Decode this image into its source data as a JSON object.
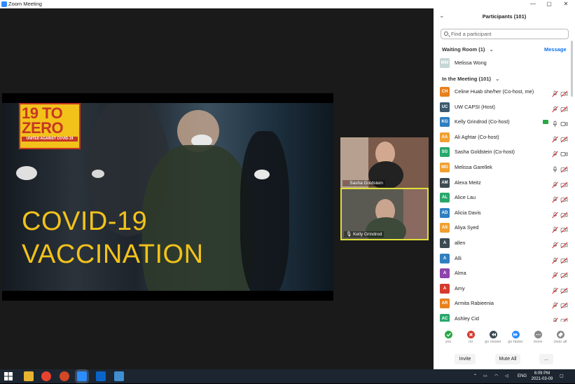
{
  "window": {
    "title": "Zoom Meeting",
    "controls": [
      "—",
      "▢",
      "✕"
    ]
  },
  "slide": {
    "logo_line1": "19 TO",
    "logo_line2": "ZERO",
    "logo_sub": "UNITED AGAINST COVID-19",
    "line1": "COVID-19",
    "line2": "VACCINATION"
  },
  "video_tiles": [
    {
      "name": "Sasha Goldstein",
      "active": false
    },
    {
      "name": "Kelly Grindrod",
      "active": true
    }
  ],
  "panel": {
    "title": "Participants (101)",
    "search_placeholder": "Find a participant",
    "waiting_room_label": "Waiting Room (1)",
    "message_label": "Message",
    "waiting": [
      {
        "initials": "MW",
        "name": "Melissa Wong",
        "color": "#c5d6d4"
      }
    ],
    "in_meeting_label": "In the Meeting (101)",
    "participants": [
      {
        "initials": "CH",
        "name": "Celine Huab she/her (Co-host, me)",
        "color": "#e8801c",
        "mic": "muted",
        "video": "off"
      },
      {
        "initials": "UC",
        "name": "UW CAPSI (Host)",
        "color": "#3c5a6e",
        "mic": "muted",
        "video": "off"
      },
      {
        "initials": "KG",
        "name": "Kelly Grindrod (Co-host)",
        "color": "#2f7fc1",
        "mic": "on",
        "video": "on",
        "share": true
      },
      {
        "initials": "AA",
        "name": "Ali Aghtar (Co-host)",
        "color": "#f0a030",
        "mic": "muted",
        "video": "off"
      },
      {
        "initials": "SG",
        "name": "Sasha Goldstein (Co-host)",
        "color": "#27a86a",
        "mic": "muted",
        "video": "on"
      },
      {
        "initials": "MG",
        "name": "Melissa Garellek",
        "color": "#f0a030",
        "mic": "on",
        "video": "off"
      },
      {
        "initials": "AM",
        "name": "Alexa Meitz",
        "color": "#3c4a52",
        "mic": "muted",
        "video": "off"
      },
      {
        "initials": "AL",
        "name": "Alice Lau",
        "color": "#27a86a",
        "mic": "muted",
        "video": "off"
      },
      {
        "initials": "AD",
        "name": "Alicia Davis",
        "color": "#2f7fc1",
        "mic": "muted",
        "video": "off"
      },
      {
        "initials": "AS",
        "name": "Aliya Syed",
        "color": "#f0a030",
        "mic": "muted",
        "video": "off"
      },
      {
        "initials": "A",
        "name": "allen",
        "color": "#3c4a52",
        "mic": "muted",
        "video": "off"
      },
      {
        "initials": "A",
        "name": "Alli",
        "color": "#2f7fc1",
        "mic": "muted",
        "video": "off"
      },
      {
        "initials": "A",
        "name": "Alma",
        "color": "#8e44ad",
        "mic": "muted",
        "video": "off"
      },
      {
        "initials": "A",
        "name": "Amy",
        "color": "#d63a2f",
        "mic": "muted",
        "video": "off"
      },
      {
        "initials": "AR",
        "name": "Armita Rabieenia",
        "color": "#e8801c",
        "mic": "muted",
        "video": "off"
      },
      {
        "initials": "AC",
        "name": "Ashley Cid",
        "color": "#27a86a",
        "mic": "muted",
        "video": "off"
      }
    ],
    "reactions": [
      {
        "label": "yes",
        "color": "#27a844",
        "icon": "check-icon"
      },
      {
        "label": "no",
        "color": "#d63a2f",
        "icon": "x-icon"
      },
      {
        "label": "go slower",
        "color": "#3c4a52",
        "icon": "rewind-icon"
      },
      {
        "label": "go faster",
        "color": "#2d8cff",
        "icon": "fast-forward-icon"
      },
      {
        "label": "more",
        "color": "#888888",
        "icon": "more-icon"
      },
      {
        "label": "clear all",
        "color": "#888888",
        "icon": "eraser-icon"
      }
    ],
    "invite_label": "Invite",
    "mute_all_label": "Mute All",
    "more_label": "..."
  },
  "taskbar": {
    "lang": "ENG",
    "time": "6:09 PM",
    "date": "2021-03-09"
  }
}
